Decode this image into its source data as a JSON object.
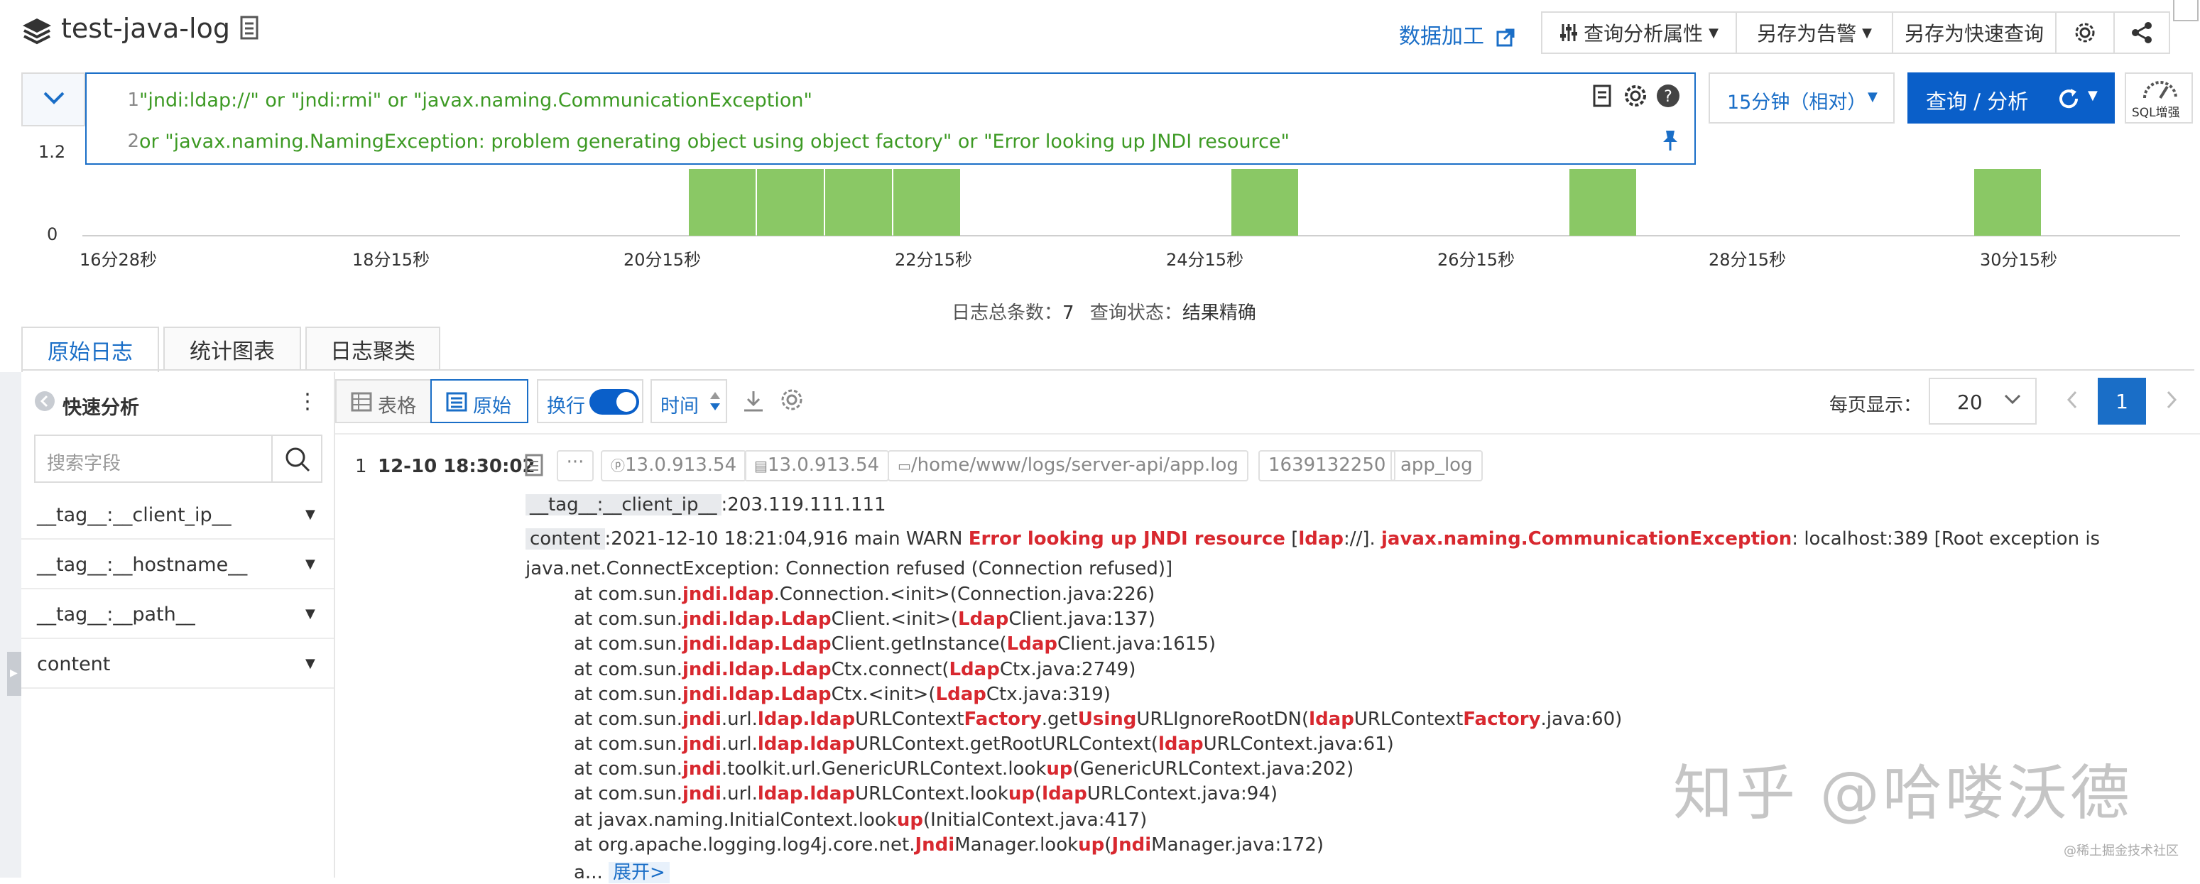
{
  "header": {
    "title": "test-java-log",
    "data_process": "数据加工",
    "query_attr": "查询分析属性",
    "save_alert": "另存为告警",
    "save_quick": "另存为快速查询"
  },
  "query": {
    "line1_no": "1",
    "line1": "\"jndi:ldap://\" or \"jndi:rmi\" or \"javax.naming.CommunicationException\"",
    "line2_no": "2",
    "line2": "or \"javax.naming.NamingException: problem generating object using object factory\" or \"Error looking up JNDI resource\"",
    "time_range": "15分钟（相对）",
    "search_label": "查询 / 分析",
    "sql_label": "SQL增强"
  },
  "histogram": {
    "y_ticks": [
      "1.2",
      "0"
    ],
    "x_ticks": [
      "16分28秒",
      "18分15秒",
      "20分15秒",
      "22分15秒",
      "24分15秒",
      "26分15秒",
      "28分15秒",
      "30分15秒"
    ],
    "bar_color": "#8ac865"
  },
  "chart_data": {
    "type": "bar",
    "x_ticks": [
      "16分28秒",
      "18分15秒",
      "20分15秒",
      "22分15秒",
      "24分15秒",
      "26分15秒",
      "28分15秒",
      "30分15秒"
    ],
    "y_ticks": [
      "0",
      "1.2"
    ],
    "ylim": [
      0,
      1.2
    ],
    "bars": [
      {
        "value": 1
      },
      {
        "value": 1
      },
      {
        "value": 1
      },
      {
        "value": 1
      },
      {
        "value": 1
      },
      {
        "value": 1
      },
      {
        "value": 1
      }
    ]
  },
  "summary": {
    "total_label": "日志总条数：",
    "total_value": "7",
    "status_label": "查询状态：",
    "status_value": "结果精确"
  },
  "tabs": [
    "原始日志",
    "统计图表",
    "日志聚类"
  ],
  "quick": {
    "title": "快速分析",
    "search_placeholder": "搜索字段",
    "fields": [
      "__tag__:__client_ip__",
      "__tag__:__hostname__",
      "__tag__:__path__",
      "content"
    ]
  },
  "toolbar": {
    "table": "表格",
    "raw": "原始",
    "wrap": "换行",
    "time": "时间",
    "page_size_label": "每页显示：",
    "page_size": "20",
    "page": "1"
  },
  "log": {
    "index": "1",
    "time": "12-10 18:30:02",
    "chips": [
      "13.0.913.54",
      "13.0.913.54",
      "/home/www/logs/server-api/app.log",
      "1639132250",
      "app_log"
    ],
    "client_ip_key": "__tag__:__client_ip__",
    "client_ip_value": ":203.119.111.111",
    "content_key": "content",
    "content_prefix": ":2021-12-10 18:21:04,916 main WARN ",
    "content_hl1": "Error looking up JNDI resource",
    "content_mid1": " [",
    "content_hl2": "ldap",
    "content_mid2": "://]. ",
    "content_hl3": "javax.naming.CommunicationException",
    "content_suffix": ": localhost:389 [Root exception is",
    "content_line2": "java.net.ConnectException: Connection refused (Connection refused)]",
    "expand": "展开>"
  },
  "watermark": "知乎 @哈喽沃德",
  "watermark_small": "@稀土掘金技术社区"
}
